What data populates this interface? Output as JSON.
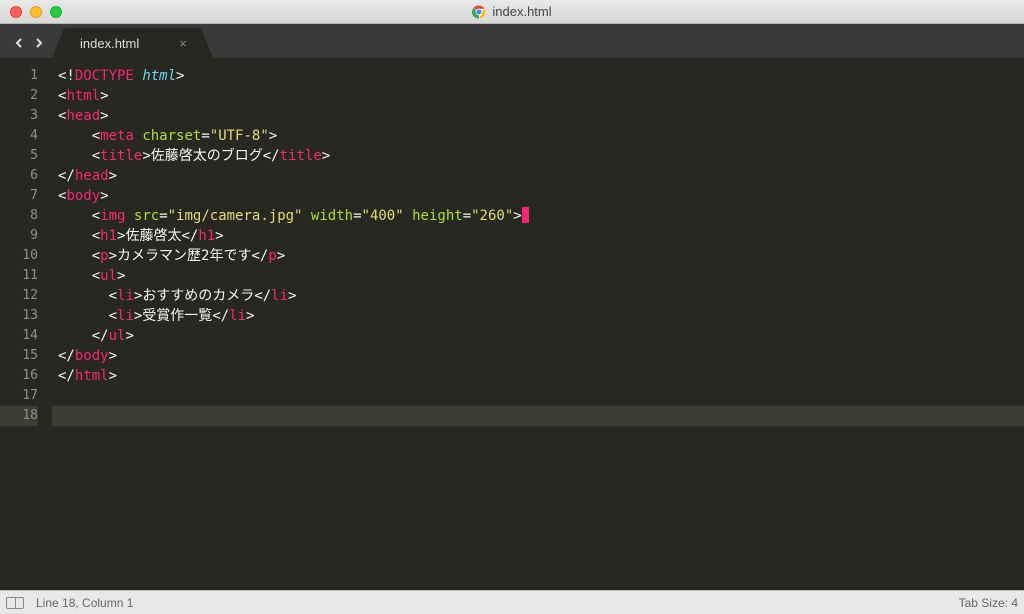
{
  "window": {
    "title": "index.html",
    "favicon": "chrome-icon"
  },
  "tab": {
    "name": "index.html",
    "close_label": "×"
  },
  "code_lines": [
    {
      "n": 1,
      "tokens": [
        {
          "c": "br",
          "t": "<!"
        },
        {
          "c": "tg",
          "t": "DOCTYPE"
        },
        {
          "c": "w",
          "t": " "
        },
        {
          "c": "kw",
          "t": "html"
        },
        {
          "c": "br",
          "t": ">"
        }
      ]
    },
    {
      "n": 2,
      "tokens": [
        {
          "c": "br",
          "t": "<"
        },
        {
          "c": "tg",
          "t": "html"
        },
        {
          "c": "br",
          "t": ">"
        }
      ]
    },
    {
      "n": 3,
      "tokens": [
        {
          "c": "br",
          "t": "<"
        },
        {
          "c": "tg",
          "t": "head"
        },
        {
          "c": "br",
          "t": ">"
        }
      ]
    },
    {
      "n": 4,
      "indent": 1,
      "tokens": [
        {
          "c": "br",
          "t": "<"
        },
        {
          "c": "tg",
          "t": "meta"
        },
        {
          "c": "w",
          "t": " "
        },
        {
          "c": "at",
          "t": "charset"
        },
        {
          "c": "op",
          "t": "="
        },
        {
          "c": "st",
          "t": "\"UTF-8\""
        },
        {
          "c": "br",
          "t": ">"
        }
      ]
    },
    {
      "n": 5,
      "indent": 1,
      "tokens": [
        {
          "c": "br",
          "t": "<"
        },
        {
          "c": "tg",
          "t": "title"
        },
        {
          "c": "br",
          "t": ">"
        },
        {
          "c": "tx",
          "t": "佐藤啓太のブログ"
        },
        {
          "c": "br",
          "t": "</"
        },
        {
          "c": "tg",
          "t": "title"
        },
        {
          "c": "br",
          "t": ">"
        }
      ]
    },
    {
      "n": 6,
      "tokens": [
        {
          "c": "br",
          "t": "</"
        },
        {
          "c": "tg",
          "t": "head"
        },
        {
          "c": "br",
          "t": ">"
        }
      ]
    },
    {
      "n": 7,
      "tokens": [
        {
          "c": "br",
          "t": "<"
        },
        {
          "c": "tg",
          "t": "body"
        },
        {
          "c": "br",
          "t": ">"
        }
      ]
    },
    {
      "n": 8,
      "indent": 1,
      "cursor": true,
      "tokens": [
        {
          "c": "br",
          "t": "<"
        },
        {
          "c": "tg",
          "t": "img"
        },
        {
          "c": "w",
          "t": " "
        },
        {
          "c": "at",
          "t": "src"
        },
        {
          "c": "op",
          "t": "="
        },
        {
          "c": "st",
          "t": "\"img/camera.jpg\""
        },
        {
          "c": "w",
          "t": " "
        },
        {
          "c": "at",
          "t": "width"
        },
        {
          "c": "op",
          "t": "="
        },
        {
          "c": "st",
          "t": "\"400\""
        },
        {
          "c": "w",
          "t": " "
        },
        {
          "c": "at",
          "t": "height"
        },
        {
          "c": "op",
          "t": "="
        },
        {
          "c": "st",
          "t": "\"260\""
        },
        {
          "c": "br",
          "t": ">"
        }
      ]
    },
    {
      "n": 9,
      "indent": 1,
      "tokens": [
        {
          "c": "br",
          "t": "<"
        },
        {
          "c": "tg",
          "t": "h1"
        },
        {
          "c": "br",
          "t": ">"
        },
        {
          "c": "tx",
          "t": "佐藤啓太"
        },
        {
          "c": "br",
          "t": "</"
        },
        {
          "c": "tg",
          "t": "h1"
        },
        {
          "c": "br",
          "t": ">"
        }
      ]
    },
    {
      "n": 10,
      "indent": 1,
      "tokens": [
        {
          "c": "br",
          "t": "<"
        },
        {
          "c": "tg",
          "t": "p"
        },
        {
          "c": "br",
          "t": ">"
        },
        {
          "c": "tx",
          "t": "カメラマン歴2年です"
        },
        {
          "c": "br",
          "t": "</"
        },
        {
          "c": "tg",
          "t": "p"
        },
        {
          "c": "br",
          "t": ">"
        }
      ]
    },
    {
      "n": 11,
      "indent": 1,
      "tokens": [
        {
          "c": "br",
          "t": "<"
        },
        {
          "c": "tg",
          "t": "ul"
        },
        {
          "c": "br",
          "t": ">"
        }
      ]
    },
    {
      "n": 12,
      "indent": 1,
      "tokens": [
        {
          "c": "w",
          "t": "  "
        },
        {
          "c": "br",
          "t": "<"
        },
        {
          "c": "tg",
          "t": "li"
        },
        {
          "c": "br",
          "t": ">"
        },
        {
          "c": "tx",
          "t": "おすすめのカメラ"
        },
        {
          "c": "br",
          "t": "</"
        },
        {
          "c": "tg",
          "t": "li"
        },
        {
          "c": "br",
          "t": ">"
        }
      ]
    },
    {
      "n": 13,
      "indent": 1,
      "tokens": [
        {
          "c": "w",
          "t": "  "
        },
        {
          "c": "br",
          "t": "<"
        },
        {
          "c": "tg",
          "t": "li"
        },
        {
          "c": "br",
          "t": ">"
        },
        {
          "c": "tx",
          "t": "受賞作一覧"
        },
        {
          "c": "br",
          "t": "</"
        },
        {
          "c": "tg",
          "t": "li"
        },
        {
          "c": "br",
          "t": ">"
        }
      ]
    },
    {
      "n": 14,
      "indent": 1,
      "tokens": [
        {
          "c": "br",
          "t": "</"
        },
        {
          "c": "tg",
          "t": "ul"
        },
        {
          "c": "br",
          "t": ">"
        }
      ]
    },
    {
      "n": 15,
      "tokens": [
        {
          "c": "br",
          "t": "</"
        },
        {
          "c": "tg",
          "t": "body"
        },
        {
          "c": "br",
          "t": ">"
        }
      ]
    },
    {
      "n": 16,
      "tokens": [
        {
          "c": "br",
          "t": "</"
        },
        {
          "c": "tg",
          "t": "html"
        },
        {
          "c": "br",
          "t": ">"
        }
      ]
    },
    {
      "n": 17,
      "tokens": []
    },
    {
      "n": 18,
      "active": true,
      "tokens": []
    }
  ],
  "status": {
    "cursor_pos": "Line 18, Column 1",
    "tab_size": "Tab Size: 4"
  }
}
